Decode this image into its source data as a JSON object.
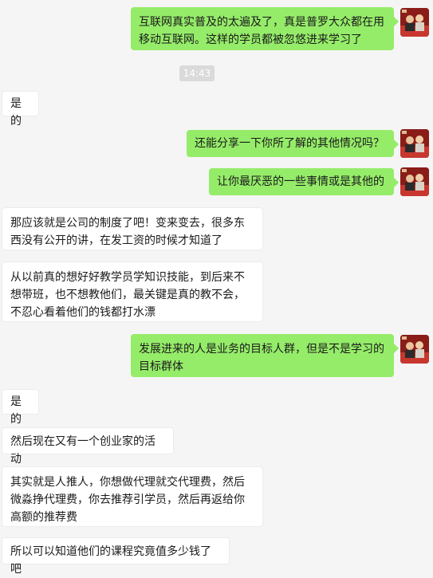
{
  "timestamp": "14:43",
  "messages": [
    {
      "side": "out",
      "text": "互联网真实普及的太遍及了，真是普罗大众都在用移动互联网。这样的学员都被忽悠进来学习了"
    },
    {
      "side": "in",
      "text": "是的"
    },
    {
      "side": "out",
      "text": "还能分享一下你所了解的其他情况吗？"
    },
    {
      "side": "out",
      "text": "让你最厌恶的一些事情或是其他的"
    },
    {
      "side": "in",
      "text": "那应该就是公司的制度了吧！变来变去，很多东西没有公开的讲，在发工资的时候才知道了"
    },
    {
      "side": "in",
      "text": "从以前真的想好好教学员学知识技能，到后来不想带班，也不想教他们，最关键是真的教不会，不忍心看着他们的钱都打水漂"
    },
    {
      "side": "out",
      "text": "发展进来的人是业务的目标人群，但是不是学习的目标群体"
    },
    {
      "side": "in",
      "text": "是的"
    },
    {
      "side": "in",
      "text": "然后现在又有一个创业家的活动"
    },
    {
      "side": "in",
      "text": "其实就是人推人，你想做代理就交代理费，然后微淼挣代理费，你去推荐引学员，然后再返给你高额的推荐费"
    },
    {
      "side": "in",
      "text": "所以可以知道他们的课程究竟值多少钱了吧"
    }
  ],
  "colors": {
    "background": "#f5f5f5",
    "outgoing_bubble": "#95ec69",
    "incoming_bubble": "#ffffff",
    "timestamp_pill": "#dadada"
  },
  "icons": {
    "avatar": "user-avatar-photo"
  }
}
